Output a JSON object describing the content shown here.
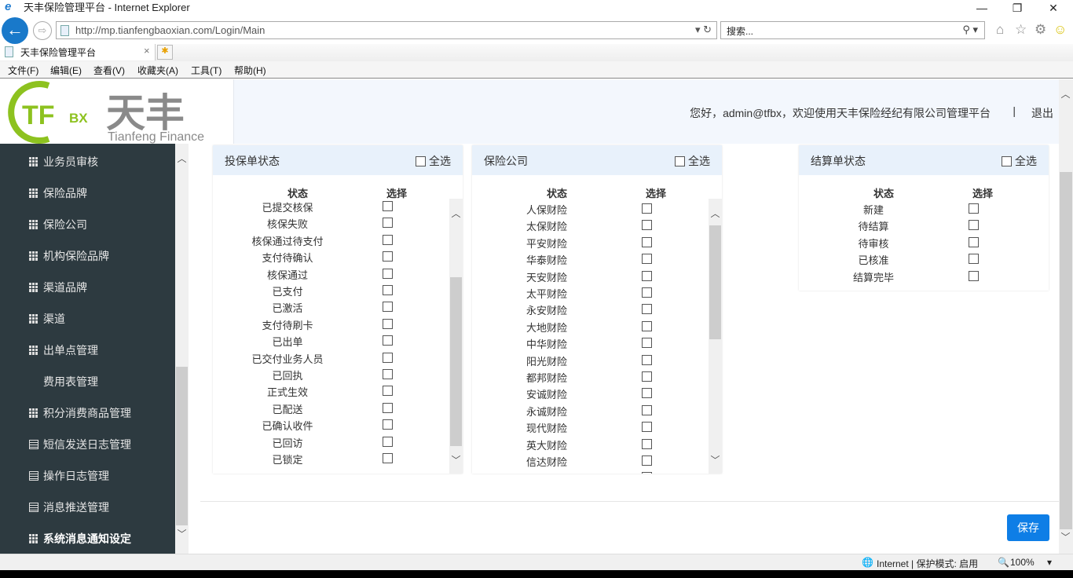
{
  "browser": {
    "window_title": "天丰保险管理平台 - Internet Explorer",
    "url": "http://mp.tianfengbaoxian.com/Login/Main",
    "search_placeholder": "搜索...",
    "tab_title": "天丰保险管理平台",
    "menu": [
      "文件(F)",
      "编辑(E)",
      "查看(V)",
      "收藏夹(A)",
      "工具(T)",
      "帮助(H)"
    ],
    "status": {
      "zone": "Internet | 保护模式: 启用",
      "zoom": "100%"
    }
  },
  "header": {
    "logo_text": "TFBX 天丰 Tianfeng Finance",
    "welcome": "您好，admin@tfbx，欢迎使用天丰保险经纪有限公司管理平台",
    "separator": "|",
    "logout": "退出"
  },
  "sidebar": {
    "items": [
      {
        "label": "业务员审核",
        "icon": "grid"
      },
      {
        "label": "保险品牌",
        "icon": "grid"
      },
      {
        "label": "保险公司",
        "icon": "grid"
      },
      {
        "label": "机构保险品牌",
        "icon": "grid"
      },
      {
        "label": "渠道品牌",
        "icon": "grid"
      },
      {
        "label": "渠道",
        "icon": "grid"
      },
      {
        "label": "出单点管理",
        "icon": "grid"
      },
      {
        "label": "费用表管理",
        "icon": "none"
      },
      {
        "label": "积分消费商品管理",
        "icon": "grid"
      },
      {
        "label": "短信发送日志管理",
        "icon": "list"
      },
      {
        "label": "操作日志管理",
        "icon": "list"
      },
      {
        "label": "消息推送管理",
        "icon": "list"
      },
      {
        "label": "系统消息通知设定",
        "icon": "grid",
        "active": true
      }
    ]
  },
  "panels": [
    {
      "title": "投保单状态",
      "select_all": "全选",
      "col_status": "状态",
      "col_select": "选择",
      "items": [
        "已提交核保",
        "核保失败",
        "核保通过待支付",
        "支付待确认",
        "核保通过",
        "已支付",
        "已激活",
        "支付待刷卡",
        "已出单",
        "已交付业务人员",
        "已回执",
        "正式生效",
        "已配送",
        "已确认收件",
        "已回访",
        "已锁定"
      ]
    },
    {
      "title": "保险公司",
      "select_all": "全选",
      "col_status": "状态",
      "col_select": "选择",
      "items": [
        "人保财险",
        "太保财险",
        "平安财险",
        "华泰财险",
        "天安财险",
        "太平财险",
        "永安财险",
        "大地财险",
        "中华财险",
        "阳光财险",
        "都邦财险",
        "安诚财险",
        "永诚财险",
        "现代财险",
        "英大财险",
        "信达财险"
      ]
    },
    {
      "title": "结算单状态",
      "select_all": "全选",
      "col_status": "状态",
      "col_select": "选择",
      "items": [
        "新建",
        "待结算",
        "待审核",
        "已核准",
        "结算完毕"
      ]
    }
  ],
  "save_label": "保存",
  "colors": {
    "sidebar_bg": "#2d3a40",
    "accent": "#0e7ee6",
    "panel_header": "#e8f1fb",
    "logo_green": "#8dc21f",
    "logo_gray": "#8a8a8a"
  }
}
